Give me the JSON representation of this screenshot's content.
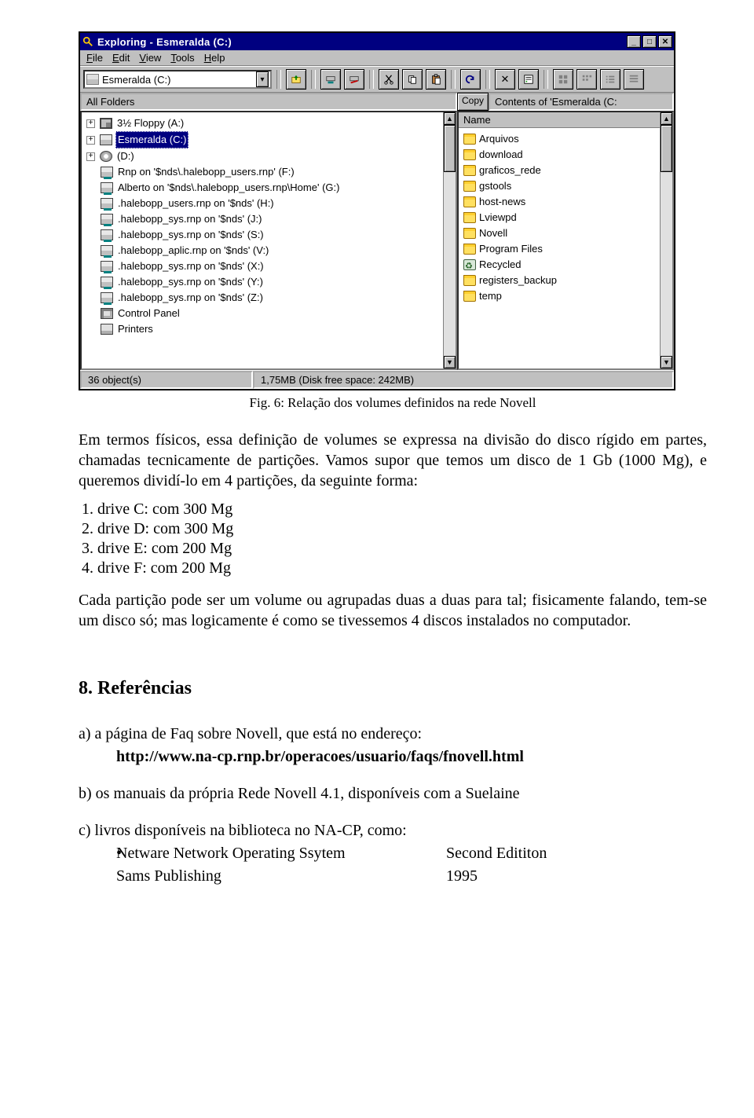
{
  "explorer": {
    "title": "Exploring - Esmeralda (C:)",
    "menu": {
      "file": "File",
      "edit": "Edit",
      "view": "View",
      "tools": "Tools",
      "help": "Help"
    },
    "drive_combo": "Esmeralda (C:)",
    "copy_btn": "Copy",
    "left_header": "All Folders",
    "right_header": "Contents of 'Esmeralda (C:",
    "name_col": "Name",
    "tree": [
      {
        "icon": "floppy",
        "label": "3½ Floppy (A:)",
        "expand": "+"
      },
      {
        "icon": "hdd",
        "label": "Esmeralda (C:)",
        "expand": "+",
        "selected": true
      },
      {
        "icon": "cd",
        "label": "(D:)",
        "expand": "+"
      },
      {
        "icon": "net",
        "label": "Rnp on '$nds\\.halebopp_users.rnp' (F:)"
      },
      {
        "icon": "net",
        "label": "Alberto on '$nds\\.halebopp_users.rnp\\Home' (G:)"
      },
      {
        "icon": "net",
        "label": ".halebopp_users.rnp on '$nds' (H:)"
      },
      {
        "icon": "net",
        "label": ".halebopp_sys.rnp on '$nds' (J:)"
      },
      {
        "icon": "net",
        "label": ".halebopp_sys.rnp on '$nds' (S:)"
      },
      {
        "icon": "net",
        "label": ".halebopp_aplic.rnp on '$nds' (V:)"
      },
      {
        "icon": "net",
        "label": ".halebopp_sys.rnp on '$nds' (X:)"
      },
      {
        "icon": "net",
        "label": ".halebopp_sys.rnp on '$nds' (Y:)"
      },
      {
        "icon": "net",
        "label": ".halebopp_sys.rnp on '$nds' (Z:)"
      },
      {
        "icon": "cpl",
        "label": "Control Panel"
      },
      {
        "icon": "printers",
        "label": "Printers"
      }
    ],
    "files": [
      {
        "icon": "folder",
        "label": "Arquivos"
      },
      {
        "icon": "folder",
        "label": "download"
      },
      {
        "icon": "folder",
        "label": "graficos_rede"
      },
      {
        "icon": "folder",
        "label": "gstools"
      },
      {
        "icon": "folder",
        "label": "host-news"
      },
      {
        "icon": "folder",
        "label": "Lviewpd"
      },
      {
        "icon": "folder",
        "label": "Novell"
      },
      {
        "icon": "folder",
        "label": "Program Files"
      },
      {
        "icon": "recycle",
        "label": "Recycled"
      },
      {
        "icon": "folder",
        "label": "registers_backup"
      },
      {
        "icon": "folder",
        "label": "temp"
      }
    ],
    "status_left": "36 object(s)",
    "status_right": "1,75MB (Disk free space: 242MB)"
  },
  "doc": {
    "caption": "Fig. 6: Relação dos volumes definidos na rede Novell",
    "para1": "Em termos físicos, essa definição de volumes se expressa na divisão do disco rígido em partes, chamadas tecnicamente de partições. Vamos supor que temos um disco de 1 Gb (1000 Mg), e queremos dividí-lo em 4 partições, da seguinte forma:",
    "drives": [
      "drive C: com 300 Mg",
      "drive D: com 300 Mg",
      "drive E: com 200 Mg",
      "drive F: com 200 Mg"
    ],
    "para2": "Cada partição pode ser um volume ou agrupadas duas a duas para tal; fisicamente falando, tem-se um disco só; mas logicamente é como se tivessemos 4 discos instalados no computador.",
    "section_title": "8. Referências",
    "ref_a_intro": "a)  a página de Faq sobre Novell, que está no endereço:",
    "ref_a_url": "http://www.na-cp.rnp.br/operacoes/usuario/faqs/fnovell.html",
    "ref_b": "b)  os manuais da própria Rede Novell 4.1, disponíveis com a Suelaine",
    "ref_c_intro": "c)  livros disponíveis na biblioteca no NA-CP, como:",
    "ref_c_book_title": "Netware Network Operating Ssytem",
    "ref_c_book_ed": "Second Edititon",
    "ref_c_pub": "Sams Publishing",
    "ref_c_year": "1995"
  }
}
